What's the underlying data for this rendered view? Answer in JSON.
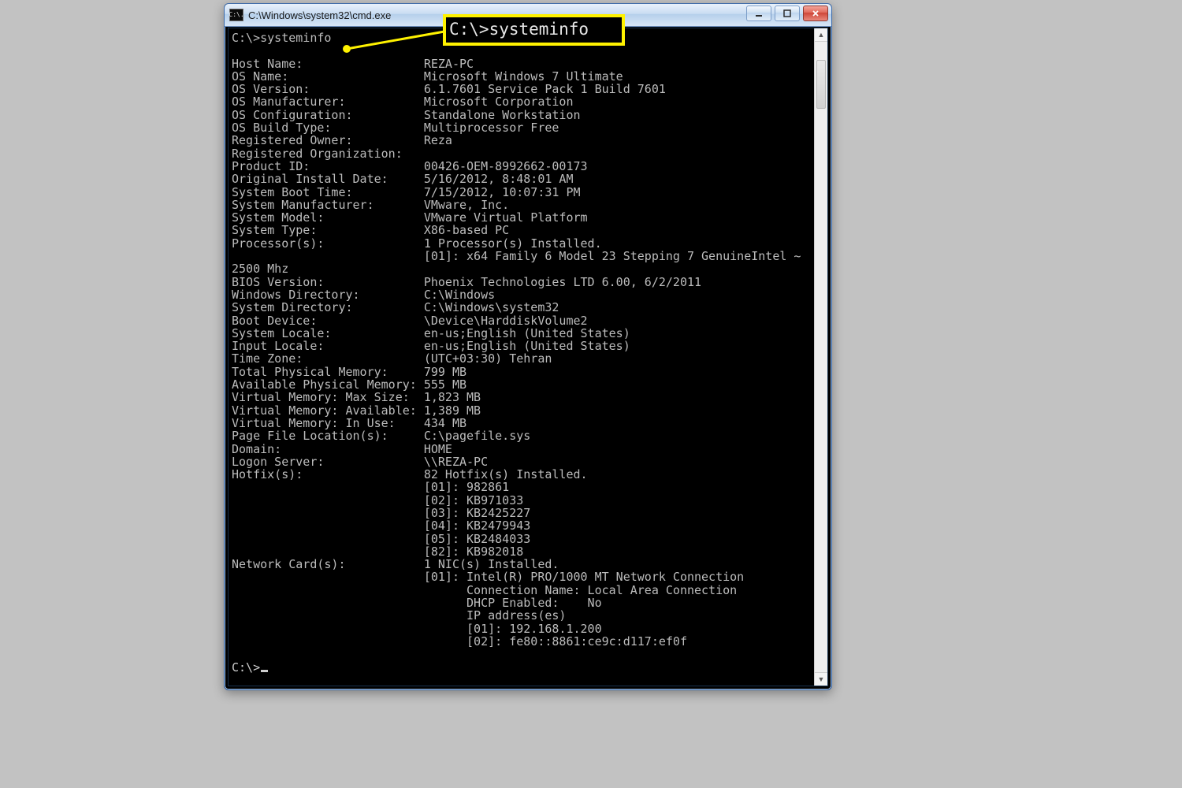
{
  "window": {
    "title": "C:\\Windows\\system32\\cmd.exe",
    "app_icon_text": "C:\\."
  },
  "callout": "C:\\>systeminfo",
  "prompt1": "C:\\>systeminfo",
  "prompt2": "C:\\>",
  "sysinfo": {
    "rows": [
      {
        "k": "Host Name:",
        "v": "REZA-PC"
      },
      {
        "k": "OS Name:",
        "v": "Microsoft Windows 7 Ultimate"
      },
      {
        "k": "OS Version:",
        "v": "6.1.7601 Service Pack 1 Build 7601"
      },
      {
        "k": "OS Manufacturer:",
        "v": "Microsoft Corporation"
      },
      {
        "k": "OS Configuration:",
        "v": "Standalone Workstation"
      },
      {
        "k": "OS Build Type:",
        "v": "Multiprocessor Free"
      },
      {
        "k": "Registered Owner:",
        "v": "Reza"
      },
      {
        "k": "Registered Organization:",
        "v": ""
      },
      {
        "k": "Product ID:",
        "v": "00426-OEM-8992662-00173"
      },
      {
        "k": "Original Install Date:",
        "v": "5/16/2012, 8:48:01 AM"
      },
      {
        "k": "System Boot Time:",
        "v": "7/15/2012, 10:07:31 PM"
      },
      {
        "k": "System Manufacturer:",
        "v": "VMware, Inc."
      },
      {
        "k": "System Model:",
        "v": "VMware Virtual Platform"
      },
      {
        "k": "System Type:",
        "v": "X86-based PC"
      },
      {
        "k": "Processor(s):",
        "v": "1 Processor(s) Installed."
      },
      {
        "k": "",
        "v": "[01]: x64 Family 6 Model 23 Stepping 7 GenuineIntel ~"
      },
      {
        "k": "2500 Mhz",
        "v": ""
      },
      {
        "k": "BIOS Version:",
        "v": "Phoenix Technologies LTD 6.00, 6/2/2011"
      },
      {
        "k": "Windows Directory:",
        "v": "C:\\Windows"
      },
      {
        "k": "System Directory:",
        "v": "C:\\Windows\\system32"
      },
      {
        "k": "Boot Device:",
        "v": "\\Device\\HarddiskVolume2"
      },
      {
        "k": "System Locale:",
        "v": "en-us;English (United States)"
      },
      {
        "k": "Input Locale:",
        "v": "en-us;English (United States)"
      },
      {
        "k": "Time Zone:",
        "v": "(UTC+03:30) Tehran"
      },
      {
        "k": "Total Physical Memory:",
        "v": "799 MB"
      },
      {
        "k": "Available Physical Memory:",
        "v": "555 MB"
      },
      {
        "k": "Virtual Memory: Max Size:",
        "v": "1,823 MB"
      },
      {
        "k": "Virtual Memory: Available:",
        "v": "1,389 MB"
      },
      {
        "k": "Virtual Memory: In Use:",
        "v": "434 MB"
      },
      {
        "k": "Page File Location(s):",
        "v": "C:\\pagefile.sys"
      },
      {
        "k": "Domain:",
        "v": "HOME"
      },
      {
        "k": "Logon Server:",
        "v": "\\\\REZA-PC"
      },
      {
        "k": "Hotfix(s):",
        "v": "82 Hotfix(s) Installed."
      },
      {
        "k": "",
        "v": "[01]: 982861"
      },
      {
        "k": "",
        "v": "[02]: KB971033"
      },
      {
        "k": "",
        "v": "[03]: KB2425227"
      },
      {
        "k": "",
        "v": "[04]: KB2479943"
      },
      {
        "k": "",
        "v": "[05]: KB2484033"
      },
      {
        "k": "",
        "v": "[82]: KB982018"
      },
      {
        "k": "Network Card(s):",
        "v": "1 NIC(s) Installed."
      },
      {
        "k": "",
        "v": "[01]: Intel(R) PRO/1000 MT Network Connection"
      }
    ],
    "net_extra": [
      "Connection Name: Local Area Connection",
      "DHCP Enabled:    No",
      "IP address(es)",
      "[01]: 192.168.1.200",
      "[02]: fe80::8861:ce9c:d117:ef0f"
    ]
  },
  "label_col_width": 27
}
